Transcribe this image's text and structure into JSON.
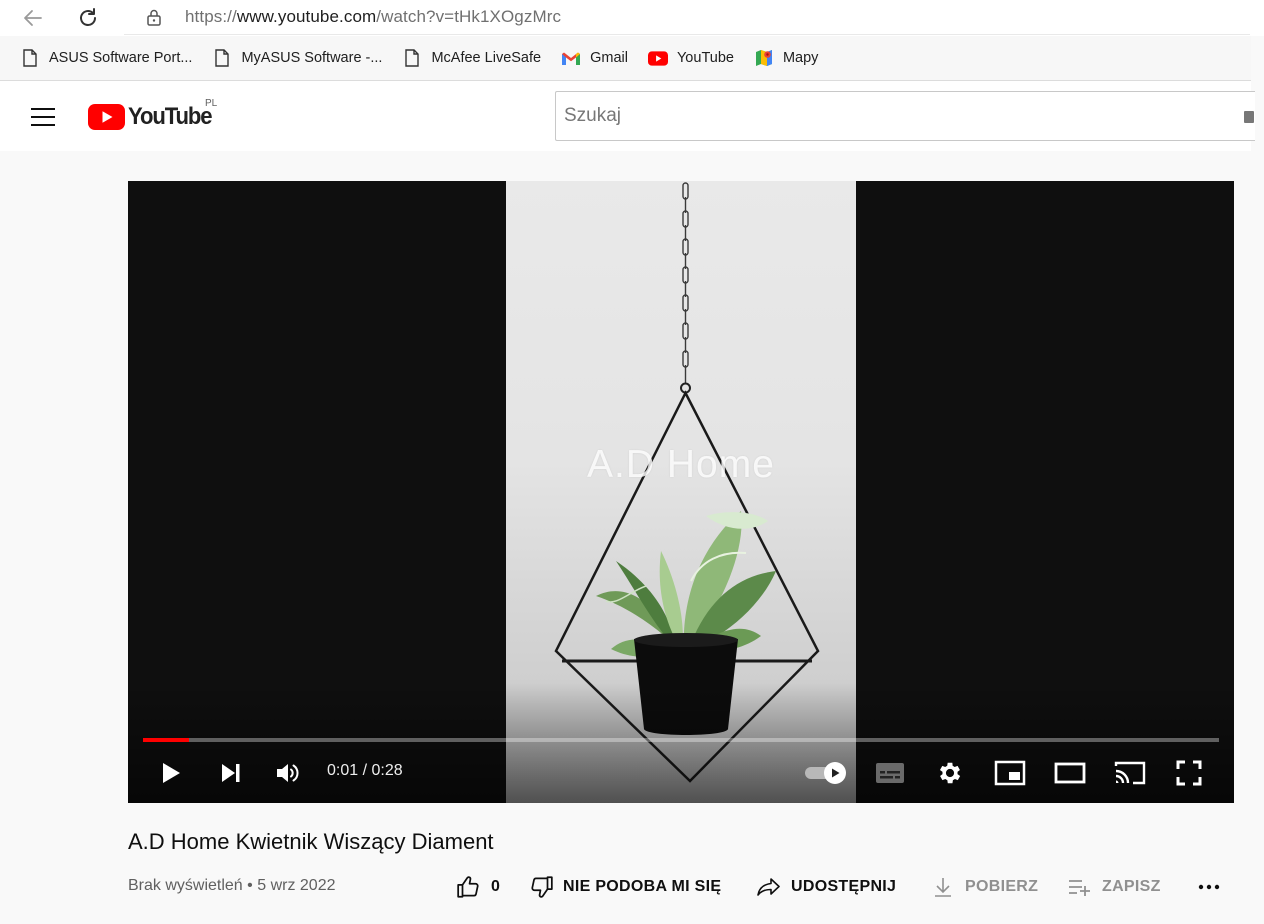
{
  "browser": {
    "url_scheme": "https://",
    "url_host": "www.youtube.com",
    "url_path": "/watch?v=tHk1XOgzMrc"
  },
  "bookmarks": [
    {
      "label": "ASUS Software Port...",
      "icon": "page-icon"
    },
    {
      "label": "MyASUS Software -...",
      "icon": "page-icon"
    },
    {
      "label": "McAfee LiveSafe",
      "icon": "page-icon"
    },
    {
      "label": "Gmail",
      "icon": "gmail-icon"
    },
    {
      "label": "YouTube",
      "icon": "youtube-icon"
    },
    {
      "label": "Mapy",
      "icon": "maps-icon"
    }
  ],
  "header": {
    "logo_text": "YouTube",
    "country_code": "PL",
    "search_placeholder": "Szukaj"
  },
  "player": {
    "watermark": "A.D Home",
    "current_time": "0:01",
    "duration": "0:28",
    "time_display": "0:01 / 0:28",
    "progress_fraction": 0.043,
    "autoplay": true
  },
  "video": {
    "title": "A.D Home Kwietnik Wiszący Diament",
    "views": "Brak wyświetleń",
    "separator": "•",
    "date": "5 wrz 2022",
    "likes": "0",
    "dislike_label": "NIE PODOBA MI SIĘ",
    "share_label": "UDOSTĘPNIJ",
    "download_label": "POBIERZ",
    "save_label": "ZAPISZ"
  },
  "colors": {
    "brand_red": "#ff0000",
    "player_bg": "#0f0f0f",
    "page_bg": "#f9f9f9"
  }
}
